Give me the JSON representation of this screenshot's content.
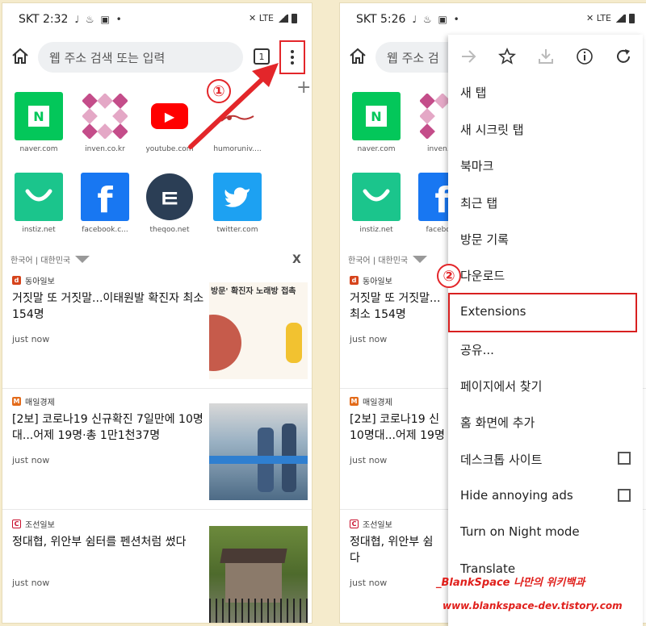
{
  "left": {
    "status": {
      "time": "SKT 2:32",
      "glyphs": "♩ ♨ ▣ •",
      "right": "✕ LTE"
    },
    "omnibox_placeholder": "웹 주소 검색 또는 입력",
    "tab_count": "1",
    "step_label": "①",
    "tiles_row1": [
      {
        "label": "naver.com",
        "glyph": "N"
      },
      {
        "label": "inven.co.kr",
        "glyph": ""
      },
      {
        "label": "youtube.com",
        "glyph": "▶"
      },
      {
        "label": "humoruniv....",
        "glyph": ""
      }
    ],
    "tiles_row2": [
      {
        "label": "instiz.net",
        "glyph": "◡"
      },
      {
        "label": "facebook.c...",
        "glyph": "f"
      },
      {
        "label": "theqoo.net",
        "glyph": "ㅌ"
      },
      {
        "label": "twitter.com",
        "glyph": "✈"
      }
    ],
    "locale": "한국어 | 대한민국",
    "close": "X",
    "cards": [
      {
        "source": "동아일보",
        "badge": "d",
        "headline": "거짓말 또 거짓말...이태원발 확진자 최소 154명",
        "time": "just now",
        "thumb_text": "방문' 확진자 노래방 접촉"
      },
      {
        "source": "매일경제",
        "badge": "M",
        "headline": "[2보] 코로나19 신규확진 7일만에 10명대...어제 19명·총 1만1천37명",
        "time": "just now"
      },
      {
        "source": "조선일보",
        "badge": "C",
        "headline": "정대협, 위안부 쉼터를 펜션처럼 썼다",
        "time": "just now"
      }
    ]
  },
  "right": {
    "status": {
      "time": "SKT 5:26",
      "glyphs": "♩ ♨ ▣ •",
      "right": "✕ LTE"
    },
    "omnibox_placeholder": "웹 주소 검",
    "step_label": "②",
    "tiles_row1": [
      {
        "label": "naver.com"
      },
      {
        "label": "inven.co"
      }
    ],
    "tiles_row2": [
      {
        "label": "instiz.net"
      },
      {
        "label": "facebook"
      }
    ],
    "locale": "한국어 | 대한민국",
    "cards": [
      {
        "source": "동아일보",
        "headline": "거짓말 또 거짓말...",
        "headline2": "최소 154명",
        "time": "just now"
      },
      {
        "source": "매일경제",
        "headline": "[2보] 코로나19 신",
        "headline2": "10명대...어제 19명",
        "time": "just now"
      },
      {
        "source": "조선일보",
        "headline": "정대협, 위안부 쉼",
        "headline2": "다",
        "time": "just now"
      }
    ],
    "menu": {
      "items": [
        "새 탭",
        "새 시크릿 탭",
        "북마크",
        "최근 탭",
        "방문 기록",
        "다운로드",
        "Extensions",
        "공유...",
        "페이지에서 찾기",
        "홈 화면에 추가",
        "데스크톱 사이트",
        "Hide annoying ads",
        "Turn on Night mode",
        "Translate"
      ]
    }
  },
  "watermark": {
    "line1": "_BlankSpace 나만의 위키백과",
    "line2": "www.blankspace-dev.tistory.com"
  },
  "colors": {
    "annotation": "#e3262a",
    "naver": "#03c75a",
    "youtube": "#ff0000",
    "facebook": "#1877f2",
    "twitter": "#1da1f2",
    "instiz": "#1bc58c"
  }
}
